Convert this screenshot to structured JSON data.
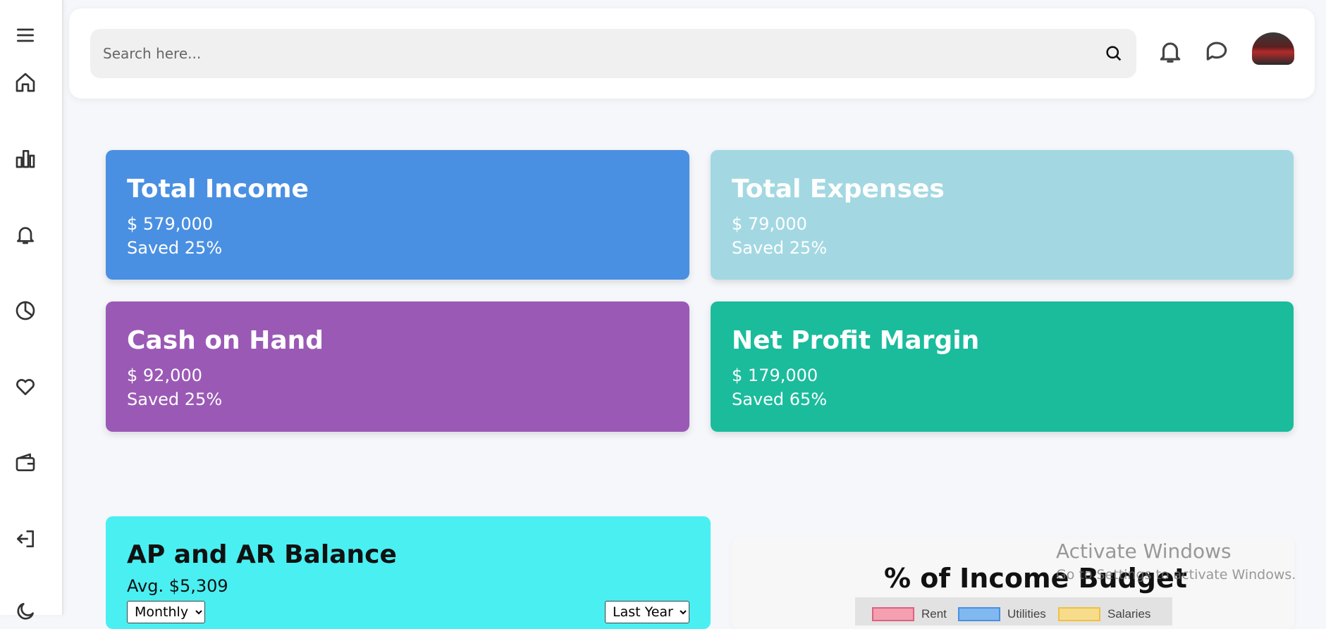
{
  "search": {
    "placeholder": "Search here..."
  },
  "sidebar": {
    "items": [
      {
        "icon": "menu-icon"
      },
      {
        "icon": "home-icon"
      },
      {
        "icon": "bar-chart-icon"
      },
      {
        "icon": "bell-icon"
      },
      {
        "icon": "pie-chart-icon"
      },
      {
        "icon": "heart-icon"
      },
      {
        "icon": "wallet-icon"
      },
      {
        "icon": "logout-icon"
      },
      {
        "icon": "moon-icon"
      }
    ]
  },
  "header": {
    "icons": [
      "bell-icon",
      "chat-icon",
      "avatar"
    ]
  },
  "cards": [
    {
      "title": "Total Income",
      "amount": "$ 579,000",
      "saved": "Saved 25%",
      "color": "#4a90e2"
    },
    {
      "title": "Total Expenses",
      "amount": "$ 79,000",
      "saved": "Saved 25%",
      "color": "#a3d8e2"
    },
    {
      "title": "Cash on Hand",
      "amount": "$ 92,000",
      "saved": "Saved 25%",
      "color": "#9b59b6"
    },
    {
      "title": "Net Profit Margin",
      "amount": "$ 179,000",
      "saved": "Saved 65%",
      "color": "#1abc9c"
    }
  ],
  "ap_ar": {
    "title": "AP and AR Balance",
    "avg": "Avg. $5,309",
    "period_select": "Monthly",
    "range_select": "Last Year",
    "bg_color": "#4aeff1"
  },
  "budget": {
    "title": "% of Income Budget",
    "legend": [
      {
        "label": "Rent",
        "color": "#f4a0b0",
        "border": "#e06080"
      },
      {
        "label": "Utilities",
        "color": "#80b8f0",
        "border": "#4a90e2"
      },
      {
        "label": "Salaries",
        "color": "#f7dc8c",
        "border": "#f0c040"
      }
    ]
  },
  "watermark": {
    "line1": "Activate Windows",
    "line2": "Go to Settings to activate Windows."
  }
}
